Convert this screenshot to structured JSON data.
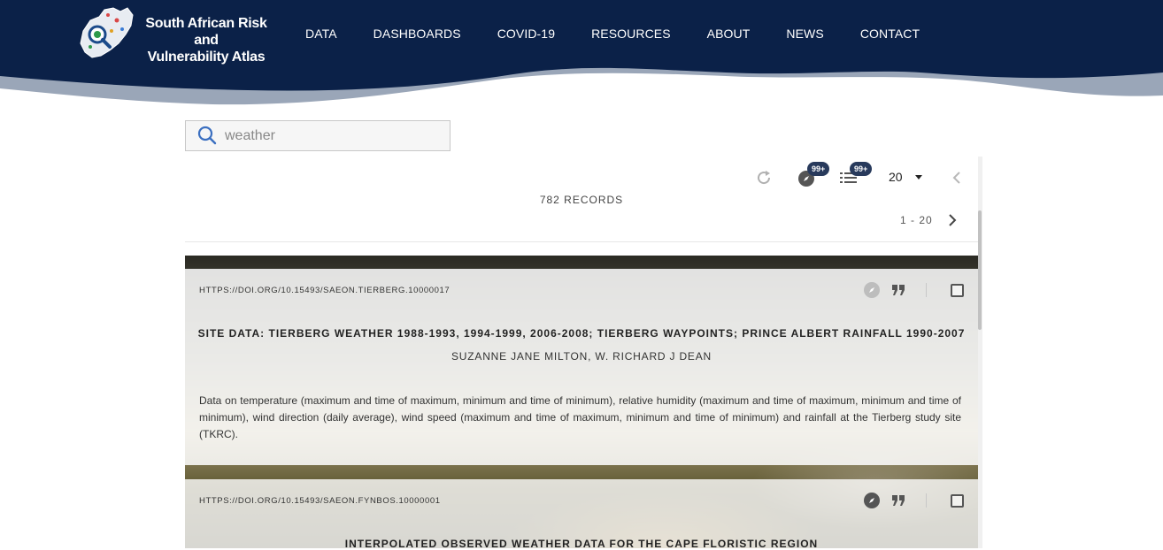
{
  "header": {
    "logo_line1": "South African Risk and",
    "logo_line2": "Vulnerability Atlas",
    "nav": [
      "DATA",
      "DASHBOARDS",
      "COVID-19",
      "RESOURCES",
      "ABOUT",
      "NEWS",
      "CONTACT"
    ]
  },
  "search": {
    "value": "weather",
    "icon": "search-icon"
  },
  "toolbar": {
    "map_badge": "99+",
    "list_badge": "99+",
    "page_size": "20",
    "records": "782 RECORDS",
    "range": "1 - 20"
  },
  "results": [
    {
      "doi": "HTTPS://DOI.ORG/10.15493/SAEON.TIERBERG.10000017",
      "title": "SITE DATA: TIERBERG WEATHER 1988-1993, 1994-1999, 2006-2008; TIERBERG WAYPOINTS; PRINCE ALBERT RAINFALL 1990-2007",
      "authors": "SUZANNE JANE MILTON, W. RICHARD J DEAN",
      "description": "Data on temperature (maximum and time of maximum, minimum and time of minimum), relative humidity (maximum and time of maximum, minimum and time of minimum), wind direction (daily average), wind speed (maximum and time of maximum, minimum and time of minimum) and rainfall at the Tierberg study site (TKRC)."
    },
    {
      "doi": "HTTPS://DOI.ORG/10.15493/SAEON.FYNBOS.10000001",
      "title": "INTERPOLATED OBSERVED WEATHER DATA FOR THE CAPE FLORISTIC REGION"
    }
  ],
  "colors": {
    "header_bg": "#0b2148",
    "wave": "#9aa6b8",
    "badge": "#283a5c"
  }
}
